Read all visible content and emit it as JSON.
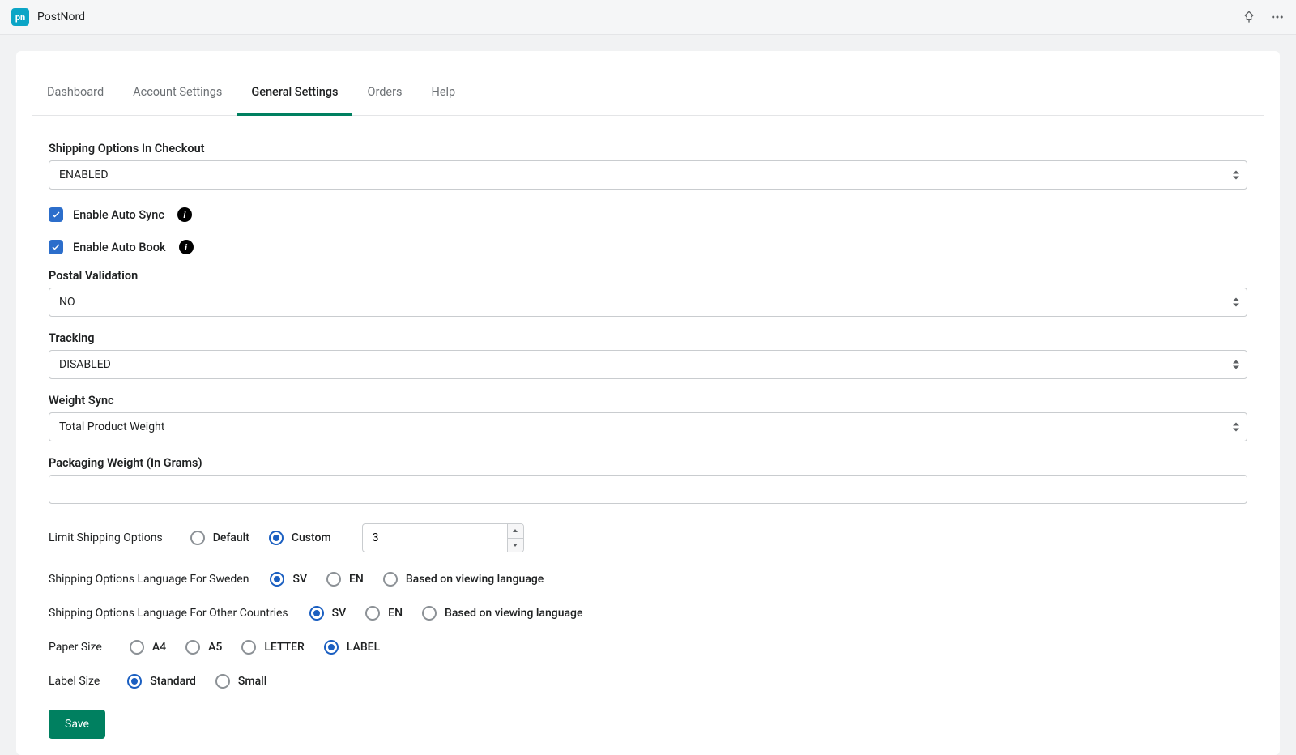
{
  "app": {
    "title": "PostNord",
    "icon_text": "pn"
  },
  "tabs": [
    {
      "label": "Dashboard"
    },
    {
      "label": "Account Settings"
    },
    {
      "label": "General Settings"
    },
    {
      "label": "Orders"
    },
    {
      "label": "Help"
    }
  ],
  "fields": {
    "shipping_options": {
      "label": "Shipping Options In Checkout",
      "value": "ENABLED"
    },
    "auto_sync": {
      "label": "Enable Auto Sync"
    },
    "auto_book": {
      "label": "Enable Auto Book"
    },
    "postal_validation": {
      "label": "Postal Validation",
      "value": "NO"
    },
    "tracking": {
      "label": "Tracking",
      "value": "DISABLED"
    },
    "weight_sync": {
      "label": "Weight Sync",
      "value": "Total Product Weight"
    },
    "packaging_weight": {
      "label": "Packaging Weight (In Grams)",
      "value": ""
    },
    "limit_shipping": {
      "label": "Limit Shipping Options",
      "option_default": "Default",
      "option_custom": "Custom",
      "value": "3"
    },
    "lang_sweden": {
      "label": "Shipping Options Language For Sweden",
      "sv": "SV",
      "en": "EN",
      "viewing": "Based on viewing language"
    },
    "lang_other": {
      "label": "Shipping Options Language For Other Countries",
      "sv": "SV",
      "en": "EN",
      "viewing": "Based on viewing language"
    },
    "paper_size": {
      "label": "Paper Size",
      "a4": "A4",
      "a5": "A5",
      "letter": "LETTER",
      "label_opt": "LABEL"
    },
    "label_size": {
      "label": "Label Size",
      "standard": "Standard",
      "small": "Small"
    }
  },
  "actions": {
    "save": "Save"
  }
}
